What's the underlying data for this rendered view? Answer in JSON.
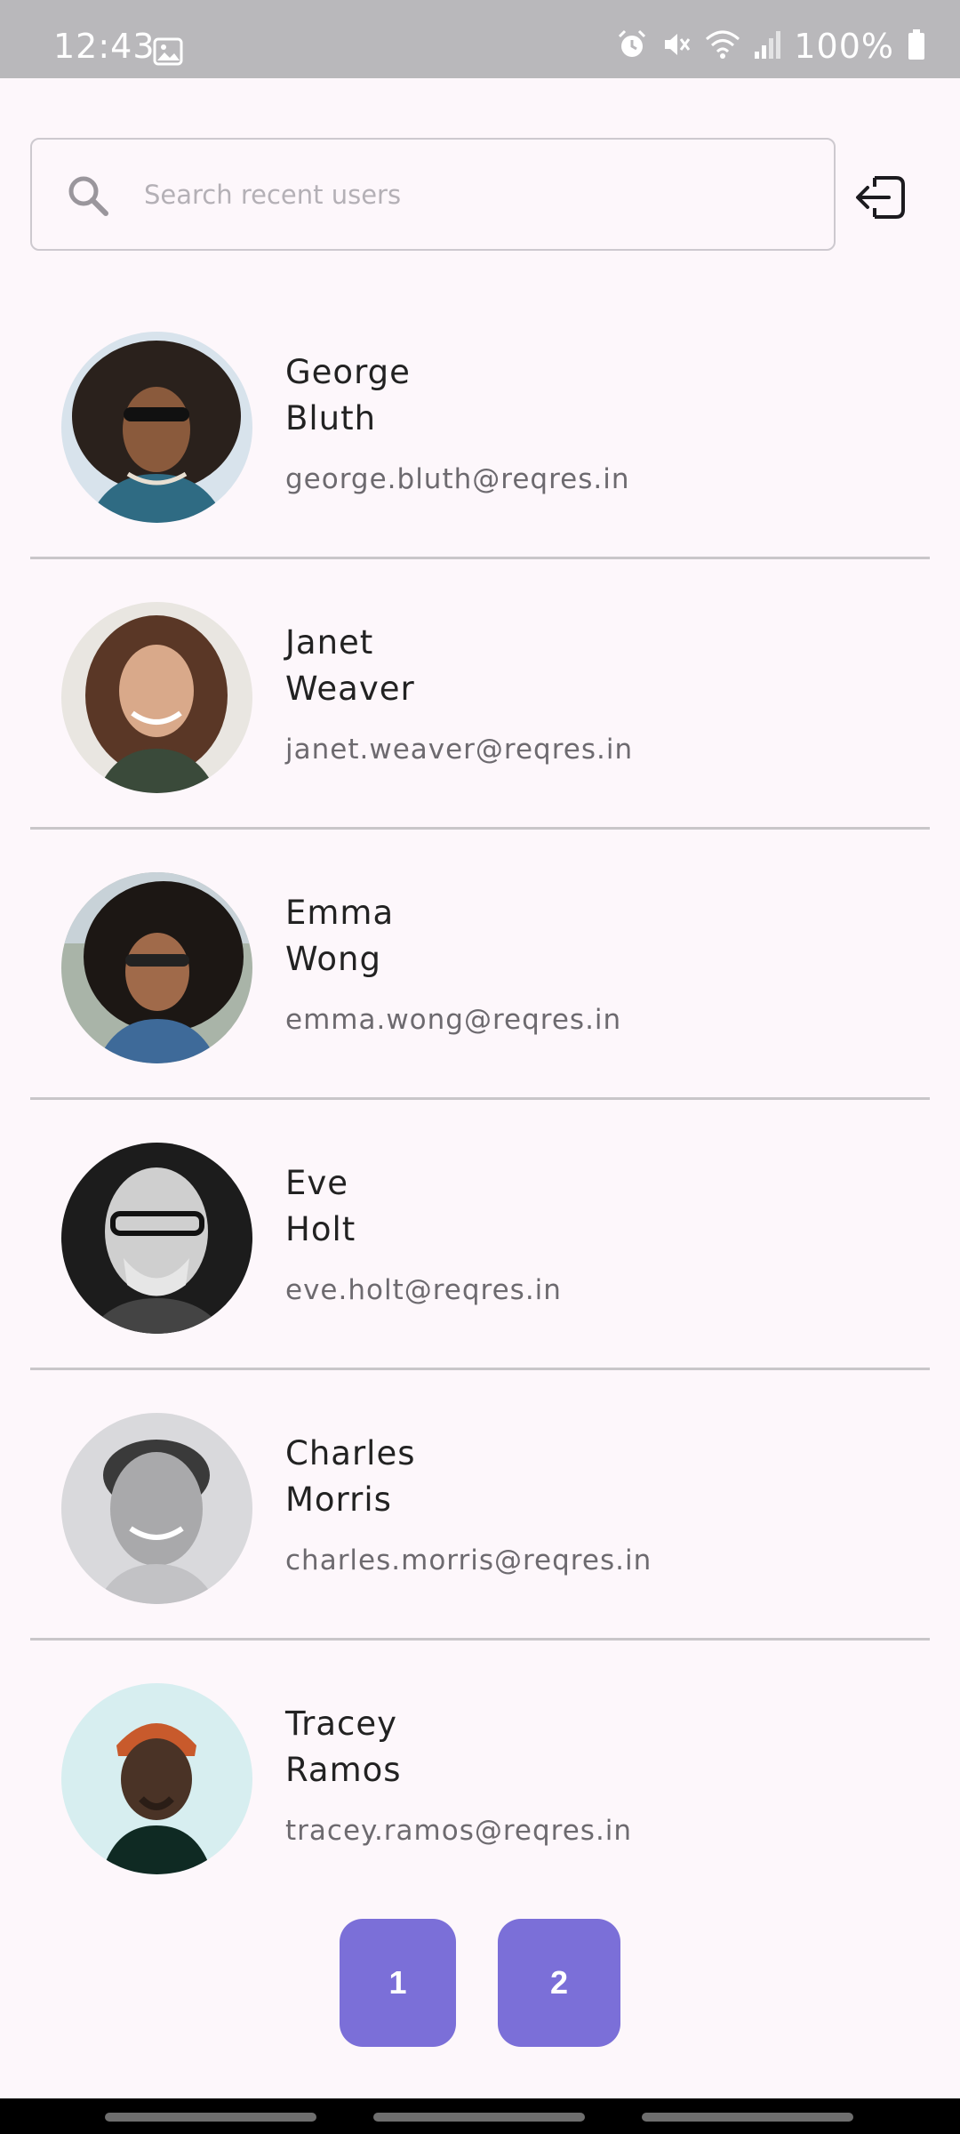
{
  "status_bar": {
    "time": "12:43",
    "battery": "100%",
    "icons": [
      "gallery-icon",
      "alarm-icon",
      "mute-icon",
      "wifi-icon",
      "signal-icon",
      "battery-icon"
    ]
  },
  "search": {
    "placeholder": "Search recent users",
    "value": ""
  },
  "header": {
    "logout_icon": "logout-icon"
  },
  "users": [
    {
      "first_name": "George",
      "last_name": "Bluth",
      "email": "george.bluth@reqres.in"
    },
    {
      "first_name": "Janet",
      "last_name": "Weaver",
      "email": "janet.weaver@reqres.in"
    },
    {
      "first_name": "Emma",
      "last_name": "Wong",
      "email": "emma.wong@reqres.in"
    },
    {
      "first_name": "Eve",
      "last_name": "Holt",
      "email": "eve.holt@reqres.in"
    },
    {
      "first_name": "Charles",
      "last_name": "Morris",
      "email": "charles.morris@reqres.in"
    },
    {
      "first_name": "Tracey",
      "last_name": "Ramos",
      "email": "tracey.ramos@reqres.in"
    }
  ],
  "pagination": {
    "pages": [
      "1",
      "2"
    ]
  },
  "colors": {
    "accent": "#7b6fd8",
    "background": "#fdf7fb",
    "status_bar": "#b9b8bb"
  }
}
